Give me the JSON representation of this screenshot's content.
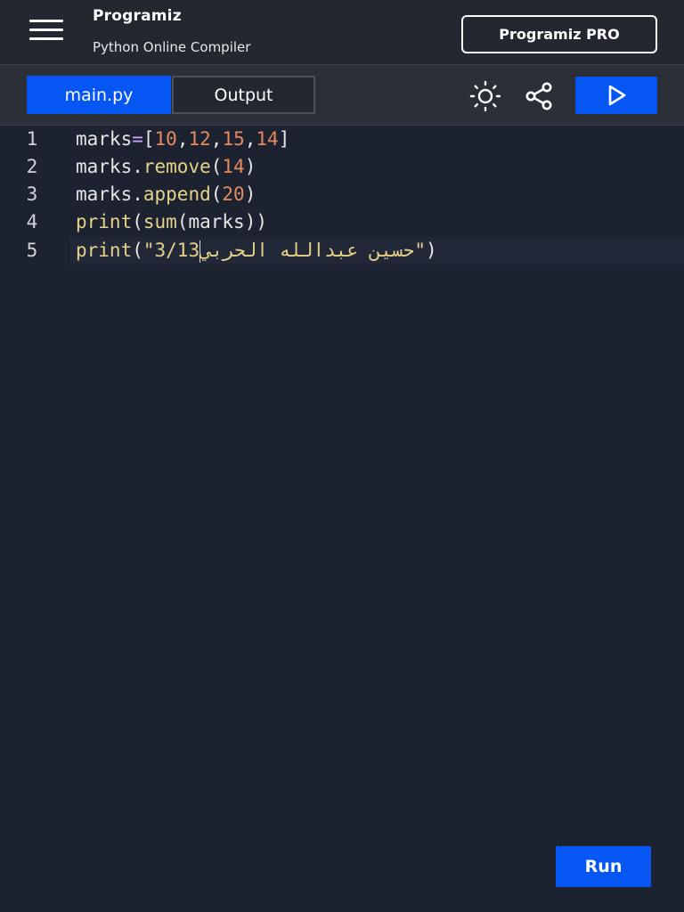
{
  "header": {
    "brand_logo": "Programiz",
    "brand_subtitle": "Python Online Compiler",
    "pro_button_label": "Programiz PRO",
    "menu_icon": "hamburger-menu-icon"
  },
  "toolbar": {
    "tabs": [
      {
        "label": "main.py",
        "active": true
      },
      {
        "label": "Output",
        "active": false
      }
    ],
    "theme_icon": "sun-icon",
    "share_icon": "share-icon",
    "run_icon": "play-icon"
  },
  "editor": {
    "lines": [
      {
        "number": "1",
        "tokens": [
          {
            "t": "marks",
            "c": "var"
          },
          {
            "t": "=",
            "c": "eq"
          },
          {
            "t": "[",
            "c": "op"
          },
          {
            "t": "10",
            "c": "num"
          },
          {
            "t": ",",
            "c": "op"
          },
          {
            "t": "12",
            "c": "num"
          },
          {
            "t": ",",
            "c": "op"
          },
          {
            "t": "15",
            "c": "num"
          },
          {
            "t": ",",
            "c": "op"
          },
          {
            "t": "14",
            "c": "num"
          },
          {
            "t": "]",
            "c": "op"
          }
        ]
      },
      {
        "number": "2",
        "tokens": [
          {
            "t": "marks",
            "c": "var"
          },
          {
            "t": ".",
            "c": "op"
          },
          {
            "t": "remove",
            "c": "fn"
          },
          {
            "t": "(",
            "c": "op"
          },
          {
            "t": "14",
            "c": "num"
          },
          {
            "t": ")",
            "c": "op"
          }
        ]
      },
      {
        "number": "3",
        "tokens": [
          {
            "t": "marks",
            "c": "var"
          },
          {
            "t": ".",
            "c": "op"
          },
          {
            "t": "append",
            "c": "fn"
          },
          {
            "t": "(",
            "c": "op"
          },
          {
            "t": "20",
            "c": "num"
          },
          {
            "t": ")",
            "c": "op"
          }
        ]
      },
      {
        "number": "4",
        "tokens": [
          {
            "t": "print",
            "c": "fn"
          },
          {
            "t": "(",
            "c": "op"
          },
          {
            "t": "sum",
            "c": "fn"
          },
          {
            "t": "(",
            "c": "op"
          },
          {
            "t": "marks",
            "c": "var"
          },
          {
            "t": "))",
            "c": "op"
          }
        ]
      },
      {
        "number": "5",
        "tokens": [
          {
            "t": "print",
            "c": "fn"
          },
          {
            "t": "(",
            "c": "op"
          },
          {
            "t": "\"3/13",
            "c": "str"
          },
          {
            "t": "|",
            "c": "caret"
          },
          {
            "t": "حسين عبدالله الحربي",
            "c": "str-ar"
          },
          {
            "t": "\"",
            "c": "str"
          },
          {
            "t": ")",
            "c": "op"
          }
        ]
      }
    ],
    "active_line": 5
  },
  "footer": {
    "run_button_label": "Run"
  },
  "colors": {
    "accent": "#0556f3",
    "background": "#1d2230",
    "header_bg": "#23272f",
    "number_token": "#e58a5e",
    "function_token": "#e5d38a"
  }
}
